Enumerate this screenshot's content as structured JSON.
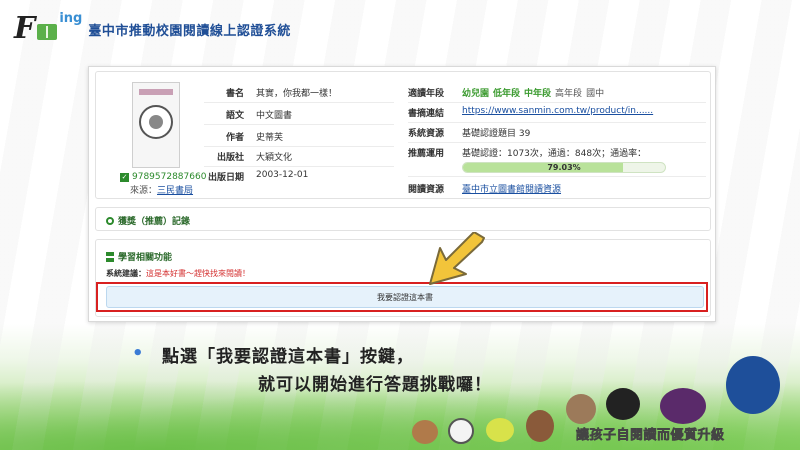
{
  "header": {
    "logo_letter": "F",
    "logo_suffix": "ing",
    "site_title": "臺中市推動校園閱讀線上認證系統"
  },
  "book": {
    "isbn": "9789572887660",
    "source_label": "來源：",
    "source_value": "三民書局",
    "fields": [
      {
        "label": "書名",
        "value": "其實，你我都一樣！"
      },
      {
        "label": "語文",
        "value": "中文圖書"
      },
      {
        "label": "作者",
        "value": "史蒂芙"
      },
      {
        "label": "出版社",
        "value": "大穎文化"
      },
      {
        "label": "出版日期",
        "value": "2003-12-01"
      }
    ]
  },
  "details": {
    "grade": {
      "label": "適讀年段",
      "levels_highlight": [
        "幼兒園",
        "低年段",
        "中年段"
      ],
      "levels_normal": [
        "高年段",
        "國中"
      ]
    },
    "link": {
      "label": "書摘連結",
      "value": "https://www.sanmin.com.tw/product/in......"
    },
    "system": {
      "label": "系統資源",
      "value": "基礎認證題目 39"
    },
    "usage": {
      "label": "推薦運用",
      "value": "基礎認證：1073次，通過：848次；通過率："
    },
    "progress": {
      "percent": 79.03,
      "text": "79.03%"
    },
    "reading": {
      "label": "閱讀資源",
      "value": "臺中市立圖書館閱讀資源"
    }
  },
  "award": {
    "title": "獲獎（推薦）記錄"
  },
  "learn": {
    "title": "學習相關功能",
    "suggest_label": "系統建議：",
    "suggest_value": "這是本好書～趕快找來閱讀！",
    "cert_button": "我要認證這本書"
  },
  "instruction": {
    "bullet": "•",
    "line1": "點選「我要認證這本書」按鍵，",
    "line2": "就可以開始進行答題挑戰囉！"
  },
  "banner": {
    "part1": "讓孩子自閱讀而",
    "part2": "優質升級"
  },
  "colors": {
    "accent_green": "#3a9a2e",
    "link_blue": "#1a4fa0",
    "highlight_red": "#d82020",
    "arrow_yellow": "#f2c43a"
  }
}
